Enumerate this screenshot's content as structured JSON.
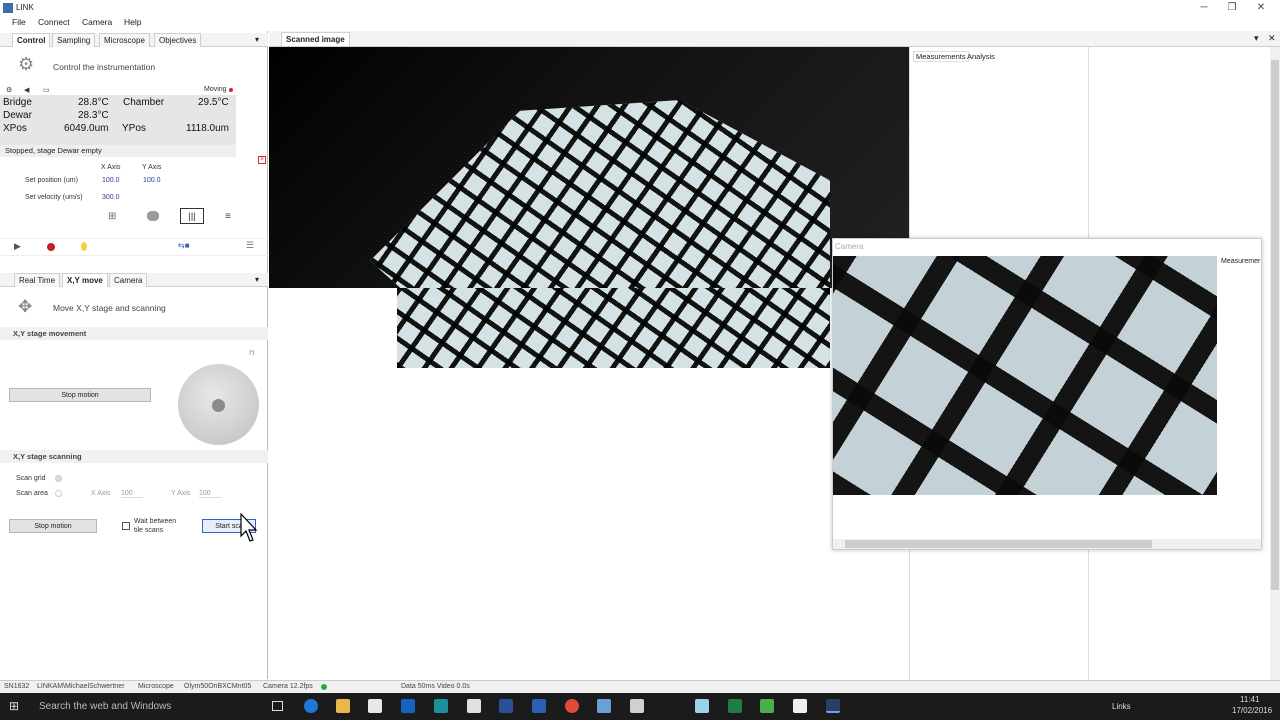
{
  "window": {
    "title": "LINK",
    "minimize": "─",
    "restore": "❐",
    "close": "✕"
  },
  "menu": [
    "File",
    "Connect",
    "Camera",
    "Help"
  ],
  "control_tabs": [
    "Control",
    "Sampling",
    "Microscope",
    "Objectives"
  ],
  "control": {
    "description": "Control the instrumentation",
    "moving_label": "Moving",
    "readouts": {
      "bridge_label": "Bridge",
      "bridge_value": "28.8°C",
      "chamber_label": "Chamber",
      "chamber_value": "29.5°C",
      "dewar_label": "Dewar",
      "dewar_value": "28.3°C",
      "xpos_label": "XPos",
      "xpos_value": "6049.0um",
      "ypos_label": "YPos",
      "ypos_value": "1118.0um"
    },
    "status": "Stopped, stage Dewar empty",
    "x_axis": "X Axis",
    "y_axis": "Y Axis",
    "set_position_label": "Set position (um)",
    "set_position_x": "100.0",
    "set_position_y": "100.0",
    "set_velocity_label": "Set velocity (um/s)",
    "set_velocity_x": "300.0"
  },
  "move_tabs": [
    "Real Time",
    "X,Y move",
    "Camera"
  ],
  "move": {
    "description": "Move X,Y stage and scanning",
    "stage_movement_heading": "X,Y stage movement",
    "stop_motion": "Stop motion",
    "stage_scanning_heading": "X,Y stage scanning",
    "scan_grid": "Scan grid",
    "scan_area": "Scan area",
    "x_axis": "X Axis",
    "x_value": "100",
    "y_axis": "Y Axis",
    "y_value": "100",
    "stop_motion_2": "Stop motion",
    "wait_between": "Wait between",
    "tile_scans": "tile scans",
    "start_scan": "Start sca"
  },
  "scanned_tab": "Scanned image",
  "right_tabs": [
    "Measurements",
    "Analysis"
  ],
  "camera_window": {
    "title": "Camera",
    "measure_tab": "Measuremer"
  },
  "statusbar": [
    "SN1632",
    "LINKAM\\MichaelSchwertner",
    "Microscope",
    "Olym50OnBXCMnt05",
    "Camera 12.2fps",
    "Data 50ms Video 0.0s"
  ],
  "taskbar": {
    "search_placeholder": "Search the web and Windows",
    "links": "Links",
    "time": "11:41",
    "date": "17/02/2016"
  }
}
